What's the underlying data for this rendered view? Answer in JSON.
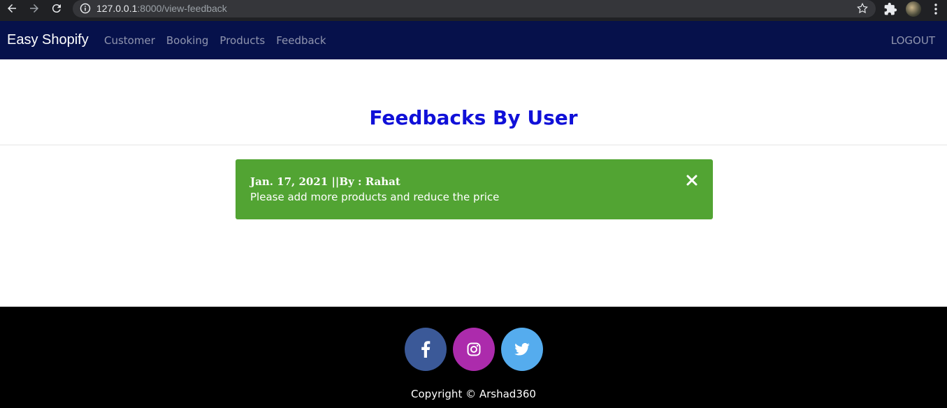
{
  "browser": {
    "url_host": "127.0.0.1",
    "url_rest": ":8000/view-feedback"
  },
  "navbar": {
    "brand": "Easy Shopify",
    "links": [
      "Customer",
      "Booking",
      "Products",
      "Feedback"
    ],
    "logout": "LOGOUT",
    "bg_color": "#06114b"
  },
  "main": {
    "title": "Feedbacks By User",
    "title_color": "#1010d8",
    "feedbacks": [
      {
        "meta": "Jan. 17, 2021 ||By : Rahat",
        "message": "Please add more products and reduce the price",
        "bg_color": "#52a433"
      }
    ]
  },
  "footer": {
    "social": [
      {
        "name": "facebook-icon",
        "color": "#3b5998"
      },
      {
        "name": "instagram-icon",
        "color": "#ac2bac"
      },
      {
        "name": "twitter-icon",
        "color": "#55acee"
      }
    ],
    "copyright": "Copyright © Arshad360"
  }
}
